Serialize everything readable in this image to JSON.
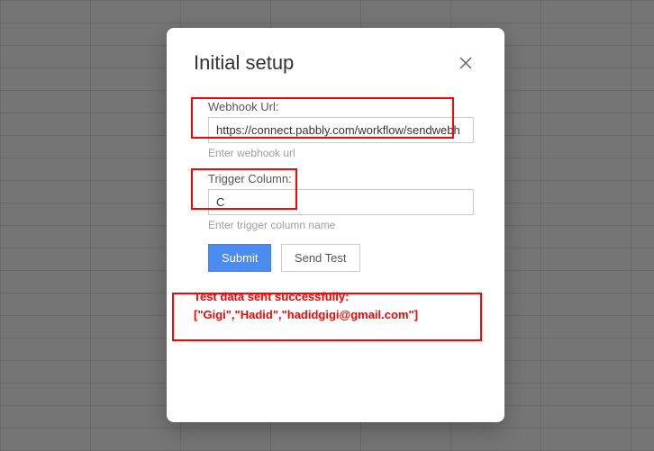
{
  "modal": {
    "title": "Initial setup",
    "webhook": {
      "label": "Webhook Url:",
      "value": "https://connect.pabbly.com/workflow/sendwebh",
      "helper": "Enter webhook url"
    },
    "trigger": {
      "label": "Trigger Column:",
      "value": "C",
      "helper": "Enter trigger column name"
    },
    "buttons": {
      "submit": "Submit",
      "sendTest": "Send Test"
    },
    "status": {
      "line1": "Test data sent successfully:",
      "line2": "[\"Gigi\",\"Hadid\",\"hadidgigi@gmail.com\"]"
    }
  }
}
